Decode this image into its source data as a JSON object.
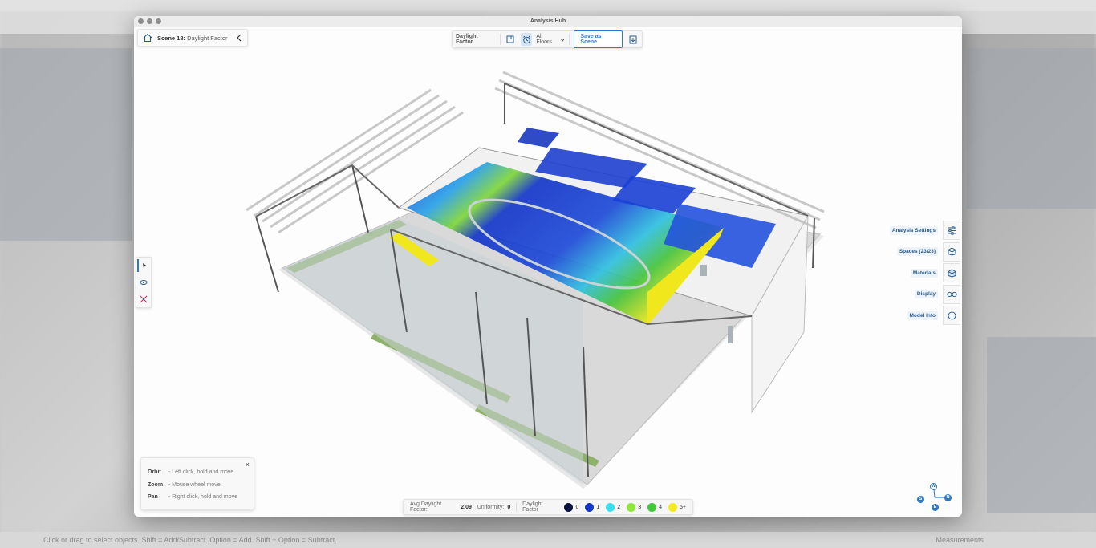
{
  "window": {
    "title": "Analysis Hub"
  },
  "scene": {
    "label": "Scene 18:",
    "name": "Daylight Factor"
  },
  "toolbar": {
    "mode_label": "Daylight Factor",
    "floors_label": "All Floors",
    "save_label": "Save as Scene"
  },
  "right_panel": {
    "items": [
      {
        "label": "Analysis Settings",
        "icon": "sliders-icon"
      },
      {
        "label": "Spaces (23/23)",
        "icon": "house-cube-icon"
      },
      {
        "label": "Materials",
        "icon": "material-cube-icon"
      },
      {
        "label": "Display",
        "icon": "glasses-icon"
      },
      {
        "label": "Model Info",
        "icon": "info-icon"
      }
    ]
  },
  "help": {
    "rows": [
      {
        "key": "Orbit",
        "desc": "- Left click, hold and move"
      },
      {
        "key": "Zoom",
        "desc": "- Mouse wheel move"
      },
      {
        "key": "Pan",
        "desc": "- Right click, hold and move"
      }
    ]
  },
  "legend": {
    "avg_label": "Avg Daylight Factor:",
    "avg_value": "2.09",
    "uniformity_label": "Uniformity:",
    "uniformity_value": "0",
    "scale_label": "Daylight Factor",
    "swatches": [
      {
        "label": "0",
        "color": "#0a1440"
      },
      {
        "label": "1",
        "color": "#1436c8"
      },
      {
        "label": "2",
        "color": "#36e0f0"
      },
      {
        "label": "3",
        "color": "#8ee63a"
      },
      {
        "label": "4",
        "color": "#3ec83a"
      },
      {
        "label": "5+",
        "color": "#f4ec1a"
      }
    ]
  },
  "compass": {
    "w": "W",
    "s": "S",
    "n": "N",
    "e": "E"
  },
  "host_status": {
    "hint": "Click or drag to select objects. Shift = Add/Subtract. Option = Add. Shift + Option = Subtract.",
    "measurements": "Measurements"
  },
  "colors": {
    "accent": "#2f78d0",
    "heat_blue": "#1436c8",
    "heat_yellow": "#f4ec1a"
  }
}
